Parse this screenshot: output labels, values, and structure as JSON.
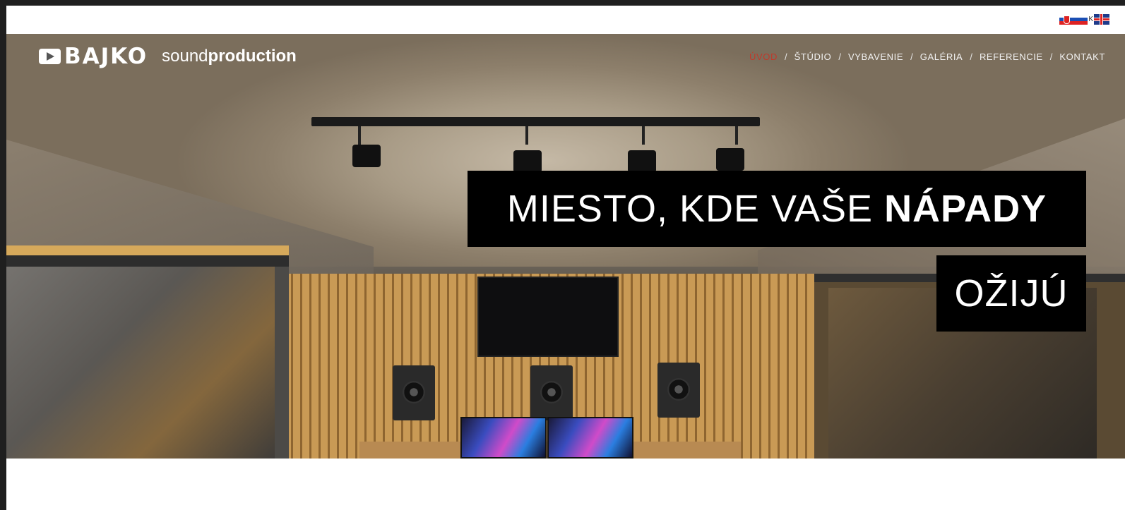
{
  "lang": {
    "items": [
      {
        "code": "sk",
        "label": "SK",
        "icon": "slovak-flag-icon"
      },
      {
        "code": "en",
        "label": "EN",
        "icon": "uk-flag-icon"
      }
    ],
    "separator": "K"
  },
  "brand": {
    "name": "BAJKO",
    "tagline_light": "sound",
    "tagline_bold": "production",
    "icon": "play-logo-icon"
  },
  "nav": {
    "items": [
      {
        "label": "ÚVOD",
        "active": true
      },
      {
        "label": "ŠTÚDIO",
        "active": false
      },
      {
        "label": "VYBAVENIE",
        "active": false
      },
      {
        "label": "GALÉRIA",
        "active": false
      },
      {
        "label": "REFERENCIE",
        "active": false
      },
      {
        "label": "KONTAKT",
        "active": false
      }
    ],
    "separator": "/",
    "active_color": "#c0392b"
  },
  "hero": {
    "line1_light": "MIESTO, KDE VAŠE ",
    "line1_bold": "NÁPADY",
    "line2": "OŽIJÚ",
    "image_alt": "recording-studio-photo"
  }
}
